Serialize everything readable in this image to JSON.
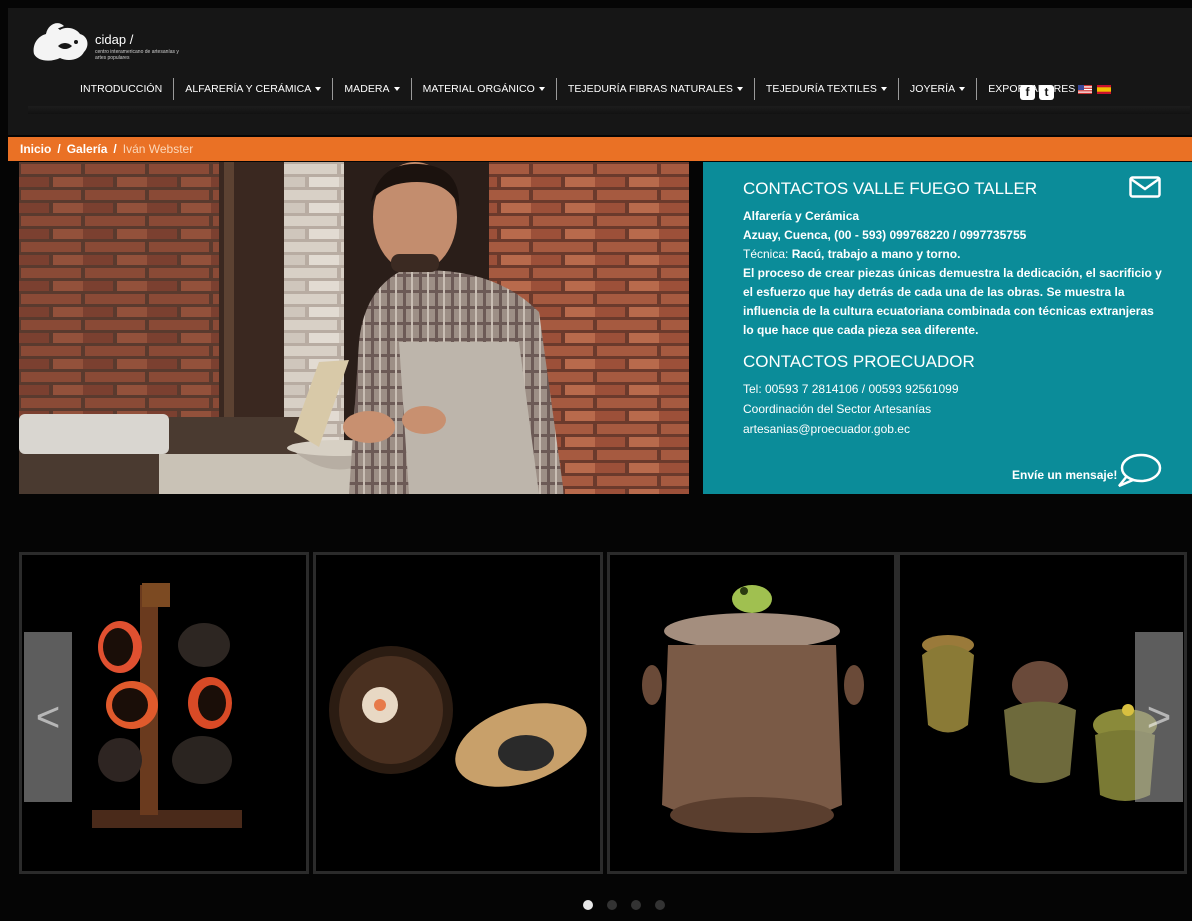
{
  "brand": {
    "name": "cidap /",
    "subtitle": "centro interamericano de artesanías y artes populares"
  },
  "nav": {
    "items": [
      {
        "label": "INTRODUCCIÓN",
        "dropdown": false
      },
      {
        "label": "ALFARERÍA Y CERÁMICA",
        "dropdown": true
      },
      {
        "label": "MADERA",
        "dropdown": true
      },
      {
        "label": "MATERIAL ORGÁNICO",
        "dropdown": true
      },
      {
        "label": "TEJEDURÍA FIBRAS NATURALES",
        "dropdown": true
      },
      {
        "label": "TEJEDURÍA TEXTILES",
        "dropdown": true
      },
      {
        "label": "JOYERÍA",
        "dropdown": true
      },
      {
        "label": "EXPORTADORES",
        "dropdown": false
      }
    ],
    "social": [
      "facebook-icon",
      "twitter-icon"
    ],
    "languages": [
      "english-flag-icon",
      "spanish-flag-icon"
    ]
  },
  "breadcrumb": {
    "home": "Inicio",
    "gallery": "Galería",
    "current": "Iván Webster",
    "separator": "/"
  },
  "contact": {
    "title": "CONTACTOS VALLE FUEGO TALLER",
    "category": "Alfarería y Cerámica",
    "location": "Azuay, Cuenca, (00 - 593) 099768220 / 0997735755",
    "technique_label": "Técnica:",
    "technique_value": "Racú, trabajo a mano y torno.",
    "description": "El proceso de crear piezas únicas demuestra la dedicación, el sacrificio y el esfuerzo que hay detrás de cada una de las obras. Se muestra la influencia de la cultura ecuatoriana combinada con técnicas extranjeras lo que hace que cada pieza sea diferente.",
    "title2": "CONTACTOS PROECUADOR",
    "tel": "Tel: 00593 7 2814106 / 00593 92561099",
    "coordination": "Coordinación del Sector Artesanías",
    "email": "artesanias@proecuador.gob.ec",
    "message_link": "Envíe un mensaje!"
  },
  "carousel": {
    "prev": "<",
    "next": ">",
    "slides": [
      "cup-tree",
      "plates",
      "jar-with-frog",
      "small-jars"
    ],
    "dots": 4,
    "active_dot": 0
  },
  "colors": {
    "orange": "#ea7125",
    "teal": "#0b8c99",
    "header": "#161616"
  }
}
